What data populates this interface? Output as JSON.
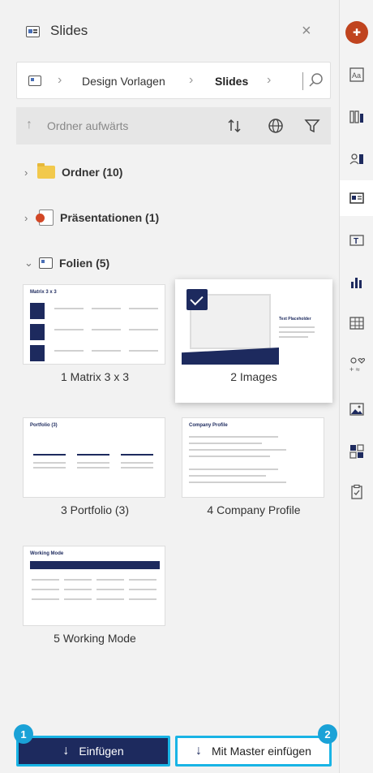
{
  "panel": {
    "title": "Slides",
    "close_glyph": "×"
  },
  "breadcrumb": {
    "items": [
      "Design Vorlagen",
      "Slides"
    ]
  },
  "toolbar": {
    "up_label": "Ordner aufwärts"
  },
  "tree": {
    "folders": "Ordner (10)",
    "presentations": "Präsentationen (1)",
    "slides": "Folien (5)"
  },
  "slides": [
    {
      "label": "1 Matrix 3 x 3",
      "thumb_title": "Matrix 3 x 3",
      "selected": false
    },
    {
      "label": "2 Images",
      "thumb_title": "Text Placeholder",
      "selected": true
    },
    {
      "label": "3 Portfolio (3)",
      "thumb_title": "Portfolio (3)",
      "selected": false
    },
    {
      "label": "4 Company Profile",
      "thumb_title": "Company Profile",
      "selected": false
    },
    {
      "label": "5 Working Mode",
      "thumb_title": "Working Mode",
      "selected": false
    }
  ],
  "buttons": {
    "insert": "Einfügen",
    "insert_master": "Mit Master einfügen",
    "badge1": "1",
    "badge2": "2"
  },
  "rail": {
    "icons": [
      "logo-icon",
      "text-styles-icon",
      "colors-icon",
      "people-icon",
      "slides-icon",
      "text-box-icon",
      "chart-icon",
      "table-icon",
      "symbols-icon",
      "image-icon",
      "layout-icon",
      "checklist-icon"
    ]
  },
  "colors": {
    "primary": "#1d2a5e",
    "highlight": "#19b4e5",
    "brand": "#c0441f"
  }
}
